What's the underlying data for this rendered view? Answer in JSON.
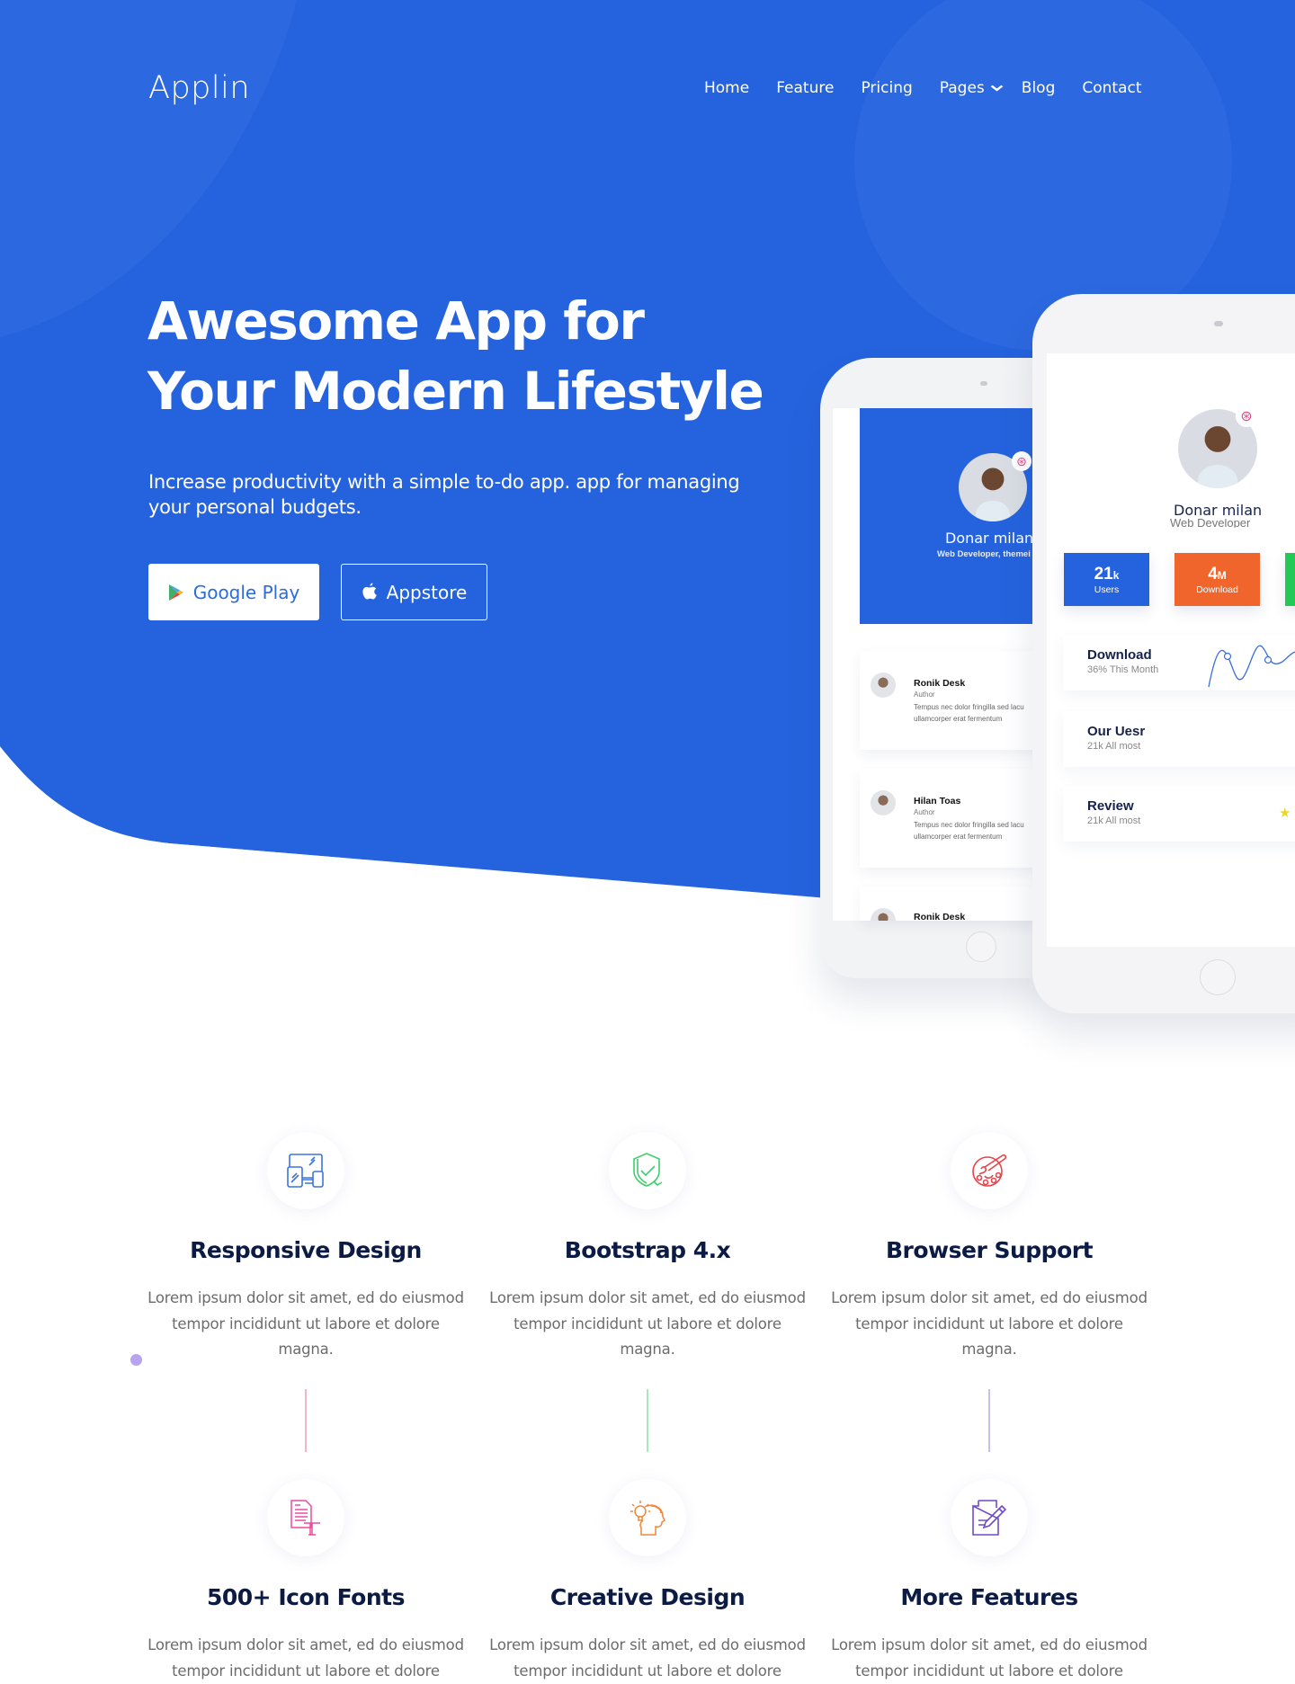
{
  "brand": {
    "logo": "Applin"
  },
  "nav": {
    "items": [
      {
        "label": "Home"
      },
      {
        "label": "Feature"
      },
      {
        "label": "Pricing"
      },
      {
        "label": "Pages",
        "has_dropdown": true
      },
      {
        "label": "Blog"
      },
      {
        "label": "Contact"
      }
    ]
  },
  "hero": {
    "title_line1": "Awesome App for",
    "title_line2": "Your Modern Lifestyle",
    "subtitle": "Increase productivity with a simple to-do app. app for managing your personal budgets.",
    "buttons": {
      "google_play": "Google Play",
      "appstore": "Appstore"
    },
    "colors": {
      "primary": "#2563de",
      "white": "#ffffff"
    }
  },
  "phone_left": {
    "profile_name": "Donar  milan",
    "profile_sub": "Web Developer, themei",
    "cards": [
      {
        "name": "Ronik Desk",
        "role": "Author",
        "text1": "Tempus nec dolor fringilla sed lacu",
        "text2": "ullamcorper erat fermentum"
      },
      {
        "name": "Hilan Toas",
        "role": "Author",
        "text1": "Tempus nec dolor fringilla sed lacu",
        "text2": "ullamcorper erat fermentum"
      },
      {
        "name": "Ronik Desk",
        "role": "",
        "text1": "",
        "text2": ""
      }
    ]
  },
  "phone_right": {
    "profile_name": "Donar  milan",
    "profile_sub": "Web Developer",
    "stats": [
      {
        "value": "21",
        "unit": "k",
        "label": "Users",
        "color": "#2563de"
      },
      {
        "value": "4",
        "unit": "M",
        "label": "Download",
        "color": "#f0652c"
      },
      {
        "value": "",
        "unit": "",
        "label": "",
        "color": "#22c954"
      }
    ],
    "rows": [
      {
        "title": "Download",
        "sub": "36% This Month"
      },
      {
        "title": "Our Uesr",
        "sub": "21k All most"
      },
      {
        "title": "Review",
        "sub": "21k All most",
        "stars_visible": 2
      }
    ]
  },
  "features": [
    {
      "title": "Responsive Design",
      "text": "Lorem ipsum dolor sit amet, ed do eiusmod tempor incididunt ut labore et dolore magna.",
      "icon": "devices-icon",
      "color": "#3b74de",
      "line_color": "#f1b6c2"
    },
    {
      "title": "Bootstrap 4.x",
      "text": "Lorem ipsum dolor sit amet, ed do eiusmod tempor incididunt ut labore et dolore magna.",
      "icon": "shield-check-icon",
      "color": "#3fcf6b",
      "line_color": "#a8e8bd"
    },
    {
      "title": "Browser Support",
      "text": "Lorem ipsum dolor sit amet, ed do eiusmod tempor incididunt ut labore et dolore magna.",
      "icon": "palette-icon",
      "color": "#e8444b",
      "line_color": "#c7c0ec"
    },
    {
      "title": "500+ Icon Fonts",
      "text": "Lorem ipsum dolor sit amet, ed do eiusmod tempor incididunt ut labore et dolore",
      "icon": "document-font-icon",
      "color": "#ec4ba0"
    },
    {
      "title": "Creative Design",
      "text": "Lorem ipsum dolor sit amet, ed do eiusmod tempor incididunt ut labore et dolore",
      "icon": "idea-head-icon",
      "color": "#f0873a"
    },
    {
      "title": "More Features",
      "text": "Lorem ipsum dolor sit amet, ed do eiusmod tempor incididunt ut labore et dolore",
      "icon": "edit-document-icon",
      "color": "#6f4bc9"
    }
  ]
}
